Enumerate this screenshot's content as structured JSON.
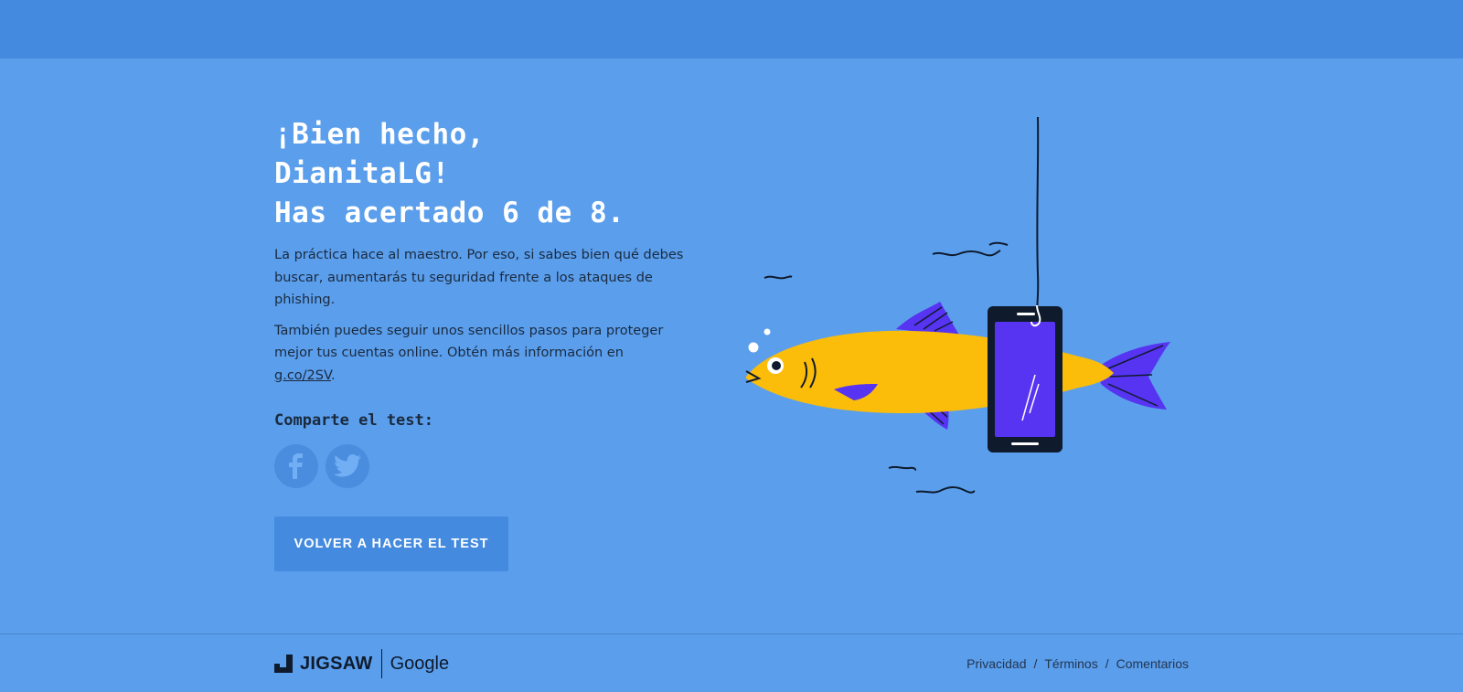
{
  "result": {
    "line1": "¡Bien hecho,",
    "line2": "DianitaLG!",
    "line3": "Has acertado 6 de 8.",
    "paragraph1": "La práctica hace al maestro. Por eso, si sabes bien qué debes buscar, aumentarás tu seguridad frente a los ataques de phishing.",
    "paragraph2_prefix": "También puedes seguir unos sencillos pasos para proteger mejor tus cuentas online. Obtén más información en ",
    "paragraph2_link": "g.co/2SV",
    "paragraph2_suffix": "."
  },
  "share": {
    "label": "Comparte el test:",
    "icons": [
      "facebook-icon",
      "twitter-icon"
    ]
  },
  "retry_button": "VOLVER A HACER EL TEST",
  "footer": {
    "brand_jigsaw": "JIGSAW",
    "brand_google": "Google",
    "links": [
      "Privacidad",
      "Términos",
      "Comentarios"
    ],
    "separator": "/"
  },
  "colors": {
    "background": "#5a9eec",
    "topbar": "#448ade",
    "fish": "#fbbd0a",
    "fins": "#5733f2",
    "phone_screen": "#5733f2"
  }
}
